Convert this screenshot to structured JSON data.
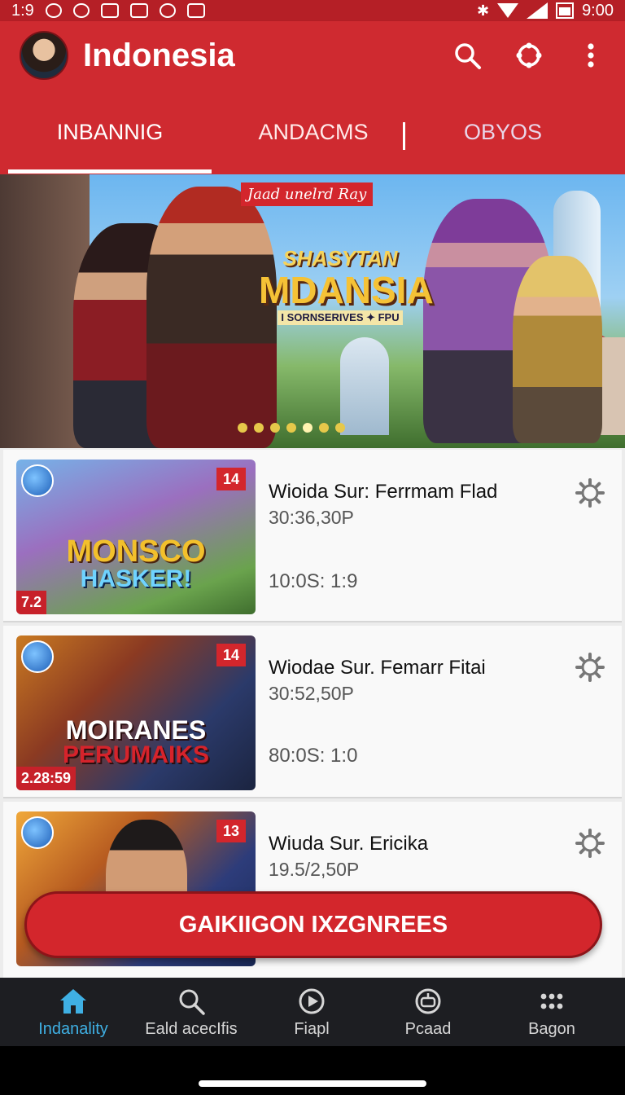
{
  "status_bar": {
    "time_left": "1:9",
    "time_right": "9:00"
  },
  "app_bar": {
    "title": "Indonesia",
    "icons": [
      "avatar",
      "search-icon",
      "refresh-icon",
      "more-vert-icon"
    ]
  },
  "tabs": [
    {
      "label": "INBANNIG",
      "active": true
    },
    {
      "label": "ANDACMS",
      "active": false
    },
    {
      "label": "OBYOS",
      "active": false
    }
  ],
  "banner": {
    "tag": "Jaad unelrd Ray",
    "logo_line1": "SHASYTAN",
    "logo_line2": "MDANSIA",
    "logo_line3": "I SORNSERIVES ✦ FPU",
    "dots_count": 7,
    "active_dot": 4
  },
  "games": [
    {
      "badge": "14",
      "corner": "7.2",
      "thumb_line1": "MONSCO",
      "thumb_line2": "HASKER!",
      "title": "Wioida Sur: Ferrmam Flad",
      "subtitle": "30:36,30P",
      "meta": "10:0S: 1:9"
    },
    {
      "badge": "14",
      "corner": "2.28:59",
      "thumb_line1": "MOIRANES",
      "thumb_line2": "PERUMAIKS",
      "title": "Wiodae Sur. Femarr Fitai",
      "subtitle": "30:52,50P",
      "meta": "80:0S: 1:0"
    },
    {
      "badge": "13",
      "title": "Wiuda Sur. Ericika",
      "subtitle": "19.5/2,50P"
    }
  ],
  "cta_label": "GAIKIIGON IXZGNREES",
  "bottom_nav": [
    {
      "label": "Indanality",
      "icon": "home-icon",
      "active": true
    },
    {
      "label": "Eald acecIfis",
      "icon": "search-icon",
      "active": false
    },
    {
      "label": "Fiapl",
      "icon": "play-icon",
      "active": false
    },
    {
      "label": "Pcaad",
      "icon": "controller-icon",
      "active": false
    },
    {
      "label": "Bagon",
      "icon": "grid-icon",
      "active": false
    }
  ],
  "colors": {
    "brand_red": "#cf2a30",
    "active_blue": "#3fb0e4",
    "nav_bg": "#1d1e22"
  }
}
